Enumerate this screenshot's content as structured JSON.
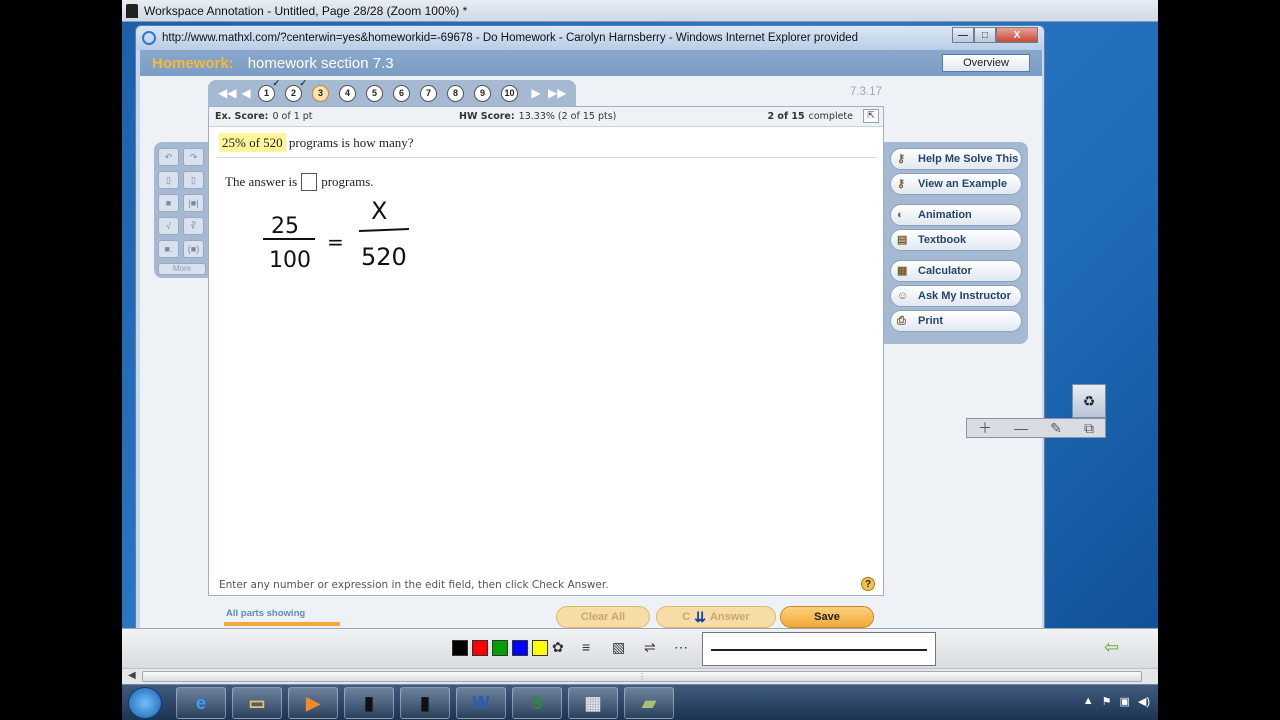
{
  "annotation_window": {
    "title": "Workspace Annotation - Untitled, Page 28/28  (Zoom 100%) *"
  },
  "browser": {
    "title": "http://www.mathxl.com/?centerwin=yes&homeworkid=-69678 - Do Homework - Carolyn Harnsberry - Windows Internet Explorer provided",
    "window_buttons": {
      "minimize": "—",
      "maximize": "□",
      "close": "X"
    }
  },
  "homework": {
    "label": "Homework:",
    "title": "homework section 7.3",
    "overview_button": "Overview",
    "version": "7.3.17",
    "nav": {
      "first": "◀◀",
      "prev": "◀",
      "next": "▶",
      "last": "▶▶",
      "questions": [
        "1",
        "2",
        "3",
        "4",
        "5",
        "6",
        "7",
        "8",
        "9",
        "10"
      ],
      "current": "3"
    },
    "score": {
      "ex_label": "Ex. Score:",
      "ex_value": "0 of 1 pt",
      "hw_label": "HW Score:",
      "hw_value": "13.33% (2 of 15 pts)",
      "complete_count": "2 of 15",
      "complete_label": "complete"
    },
    "question": {
      "highlight": "25% of 520",
      "rest": " programs is how many?"
    },
    "answer": {
      "prefix": "The answer is",
      "suffix": "programs."
    },
    "handwriting": {
      "num_left": "25",
      "den_left": "100",
      "equals": "=",
      "num_right": "X",
      "den_right": "520"
    },
    "hint": "Enter any number or expression in the edit field, then click Check Answer.",
    "help_symbol": "?",
    "palette": {
      "more": "More"
    },
    "tools": [
      {
        "label": "Help Me Solve This",
        "icon": "key-icon"
      },
      {
        "label": "View an Example",
        "icon": "key-icon"
      },
      {
        "label": "Animation",
        "icon": "animation-icon"
      },
      {
        "label": "Textbook",
        "icon": "book-icon"
      },
      {
        "label": "Calculator",
        "icon": "calculator-icon"
      },
      {
        "label": "Ask My Instructor",
        "icon": "person-icon"
      },
      {
        "label": "Print",
        "icon": "printer-icon"
      }
    ],
    "all_parts": "All parts showing",
    "buttons": {
      "clear_all": "Clear All",
      "check_answer_start": "C",
      "check_answer_end": "Answer",
      "save": "Save"
    }
  },
  "annotation_toolbar": {
    "colors": [
      "#000000",
      "#ff0000",
      "#00a000",
      "#0000ff",
      "#ffff00"
    ]
  },
  "taskbar": {
    "apps": [
      "internet-explorer",
      "file-explorer",
      "media-player",
      "annotation-pen",
      "annotation-pen",
      "word",
      "excel",
      "calculator",
      "notes"
    ]
  }
}
